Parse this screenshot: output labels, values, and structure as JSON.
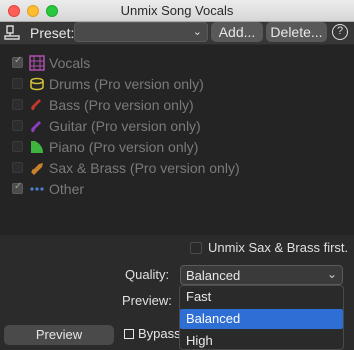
{
  "window": {
    "title": "Unmix Song Vocals"
  },
  "preset": {
    "label": "Preset:",
    "value": "",
    "add_label": "Add...",
    "delete_label": "Delete...",
    "help_label": "?"
  },
  "stems": [
    {
      "label": "Vocals",
      "checked": true,
      "icon": "vocals-icon"
    },
    {
      "label": "Drums (Pro version only)",
      "checked": false,
      "icon": "drum-icon"
    },
    {
      "label": "Bass (Pro version only)",
      "checked": false,
      "icon": "bass-guitar-icon"
    },
    {
      "label": "Guitar (Pro version only)",
      "checked": false,
      "icon": "guitar-icon"
    },
    {
      "label": "Piano (Pro version only)",
      "checked": false,
      "icon": "piano-icon"
    },
    {
      "label": "Sax & Brass (Pro version only)",
      "checked": false,
      "icon": "trumpet-icon"
    },
    {
      "label": "Other",
      "checked": true,
      "icon": "dots-icon"
    }
  ],
  "options": {
    "unmix_first_label": "Unmix Sax & Brass first.",
    "quality_label": "Quality:",
    "quality_value": "Balanced",
    "preview_label": "Preview:"
  },
  "dropdown": {
    "items": [
      "Fast",
      "Balanced",
      "High"
    ],
    "selected": "Balanced"
  },
  "bottom": {
    "preview_button": "Preview",
    "bypass_label": "Bypass"
  },
  "colors": {
    "accent": "#2d6fd4",
    "vocals_icon": "#b04fb0",
    "drums_icon": "#d6c23a",
    "bass_icon": "#c0392b",
    "guitar_icon": "#8e3fbf",
    "piano_icon": "#3fb33f",
    "sax_icon": "#c9822b",
    "other_icon": "#4a7fd1"
  }
}
